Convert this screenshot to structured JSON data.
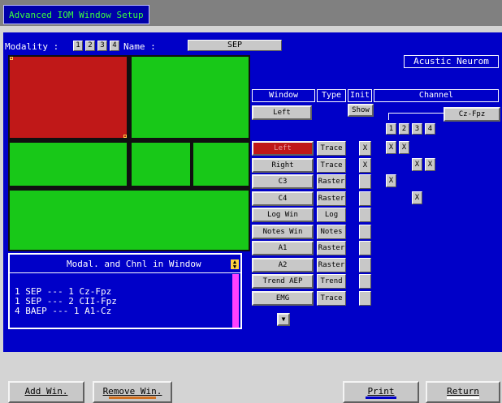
{
  "title": "Advanced IOM Window Setup",
  "modality": {
    "label": "Modality :",
    "buttons": [
      "1",
      "2",
      "3",
      "4"
    ]
  },
  "name": {
    "label": "Name :",
    "value": "SEP"
  },
  "acustic_label": "Acustic Neurom",
  "headers": {
    "window": "Window",
    "type": "Type",
    "init": "Init",
    "channel": "Channel"
  },
  "selected_window": "Left",
  "show_label": "Show",
  "channel_value": "Cz-Fpz",
  "channel_numbers": [
    "1",
    "2",
    "3",
    "4"
  ],
  "rows": [
    {
      "window": "Left",
      "type": "Trace",
      "init": "X",
      "ch": [
        "X",
        "X",
        "",
        ""
      ]
    },
    {
      "window": "Right",
      "type": "Trace",
      "init": "X",
      "ch": [
        "",
        "",
        "X",
        "X"
      ]
    },
    {
      "window": "C3",
      "type": "Raster",
      "init": "",
      "ch": [
        "X",
        "",
        "",
        ""
      ]
    },
    {
      "window": "C4",
      "type": "Raster",
      "init": "",
      "ch": [
        "",
        "",
        "X",
        ""
      ]
    },
    {
      "window": "Log Win",
      "type": "Log",
      "init": "",
      "ch": [
        "",
        "",
        "",
        ""
      ]
    },
    {
      "window": "Notes Win",
      "type": "Notes",
      "init": "",
      "ch": [
        "",
        "",
        "",
        ""
      ]
    },
    {
      "window": "A1",
      "type": "Raster",
      "init": "",
      "ch": [
        "",
        "",
        "",
        ""
      ]
    },
    {
      "window": "A2",
      "type": "Raster",
      "init": "",
      "ch": [
        "",
        "",
        "",
        ""
      ]
    },
    {
      "window": "Trend AEP",
      "type": "Trend",
      "init": "",
      "ch": [
        "",
        "",
        "",
        ""
      ]
    },
    {
      "window": "EMG",
      "type": "Trace",
      "init": "",
      "ch": [
        "",
        "",
        "",
        ""
      ]
    }
  ],
  "modal_panel": {
    "header": "Modal. and Chnl in Window",
    "items": [
      "1 SEP --- 1 Cz-Fpz",
      "1 SEP --- 2 CII-Fpz",
      "4 BAEP --- 1 A1-Cz"
    ]
  },
  "footer": {
    "add": "Add Win.",
    "remove": "Remove Win.",
    "print": "Print",
    "return": "Return"
  },
  "colors": {
    "main_bg": "#0000c8",
    "pane_red": "#c01818",
    "pane_green": "#18c818",
    "scroll_pink": "#ff40ff"
  }
}
